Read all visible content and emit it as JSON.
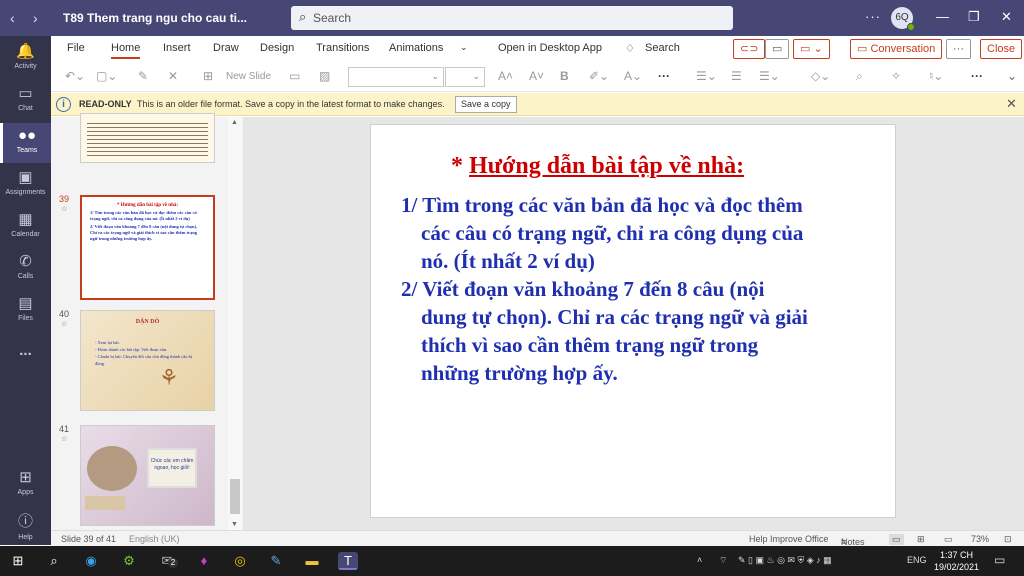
{
  "window": {
    "title": "T89 Them trang ngu cho cau ti...",
    "search_placeholder": "Search",
    "avatar_initials": "6Q"
  },
  "rail": [
    {
      "label": "Activity",
      "icon": "bell-icon"
    },
    {
      "label": "Chat",
      "icon": "chat-icon"
    },
    {
      "label": "Teams",
      "icon": "teams-icon"
    },
    {
      "label": "Assignments",
      "icon": "assignments-icon"
    },
    {
      "label": "Calendar",
      "icon": "calendar-icon"
    },
    {
      "label": "Calls",
      "icon": "phone-icon"
    },
    {
      "label": "Files",
      "icon": "files-icon"
    },
    {
      "label": "...",
      "icon": "more-icon"
    },
    {
      "label": "Apps",
      "icon": "apps-icon"
    },
    {
      "label": "Help",
      "icon": "help-icon"
    }
  ],
  "menu": {
    "tabs": [
      "File",
      "Home",
      "Insert",
      "Draw",
      "Design",
      "Transitions",
      "Animations"
    ],
    "active_tab": "Home",
    "open_desktop": "Open in Desktop App",
    "search": "Search",
    "conversation": "Conversation",
    "close": "Close"
  },
  "toolbar": {
    "new_slide": "New Slide"
  },
  "infobar": {
    "readonly": "READ-ONLY",
    "message": "This is an older file format. Save a copy in the latest format to make changes.",
    "save_copy": "Save a copy"
  },
  "thumbnails": [
    {
      "number": "39",
      "title": "* Hướng dẫn bài tập về nhà:",
      "lines": [
        "1/ Tìm trong các văn bản đã học và đọc thêm các câu có trạng ngữ, chỉ ra công dụng của nó. (Ít nhất 2 ví dụ)",
        "2/ Viết đoạn văn khoảng 7 đến 8 câu (nội dung tự chọn). Chỉ ra các trạng ngữ và giải thích vì sao cần thêm trạng ngữ trong những trường hợp ấy."
      ]
    },
    {
      "number": "40",
      "title": "DẶN DÒ",
      "lines": [
        "- Xem lại bài.",
        "- Hoàn thành các bài tập: Viết đoạn văn.",
        "- Chuẩn bị bài: Chuyển đổi câu chủ động thành câu bị động."
      ]
    },
    {
      "number": "41",
      "card": "Chúc các em chăm ngoan, học giỏi!"
    }
  ],
  "slide": {
    "title_star": "* ",
    "title": "Hướng dẫn bài tập về nhà:",
    "lines": [
      "1/ Tìm trong các văn bản đã học và đọc thêm",
      "các câu có trạng ngữ, chỉ ra công dụng của",
      "nó. (Ít nhất 2 ví dụ)",
      "2/ Viết đoạn văn khoảng 7 đến 8 câu (nội",
      "dung tự chọn). Chỉ ra các trạng ngữ và giải",
      "thích vì sao cần thêm trạng ngữ trong",
      "những trường hợp ấy."
    ]
  },
  "status": {
    "slide_count": "Slide 39 of 41",
    "language": "English (UK)",
    "help": "Help Improve Office",
    "notes": "Notes",
    "zoom": "73%"
  },
  "taskbar": {
    "lang": "ENG",
    "time": "1:37 CH",
    "date": "19/02/2021",
    "mail_badge": "2"
  },
  "colors": {
    "teams_purple": "#464775",
    "accent_red": "#c43e1c",
    "slide_title": "#cc0000",
    "slide_body": "#1f2fb0"
  }
}
